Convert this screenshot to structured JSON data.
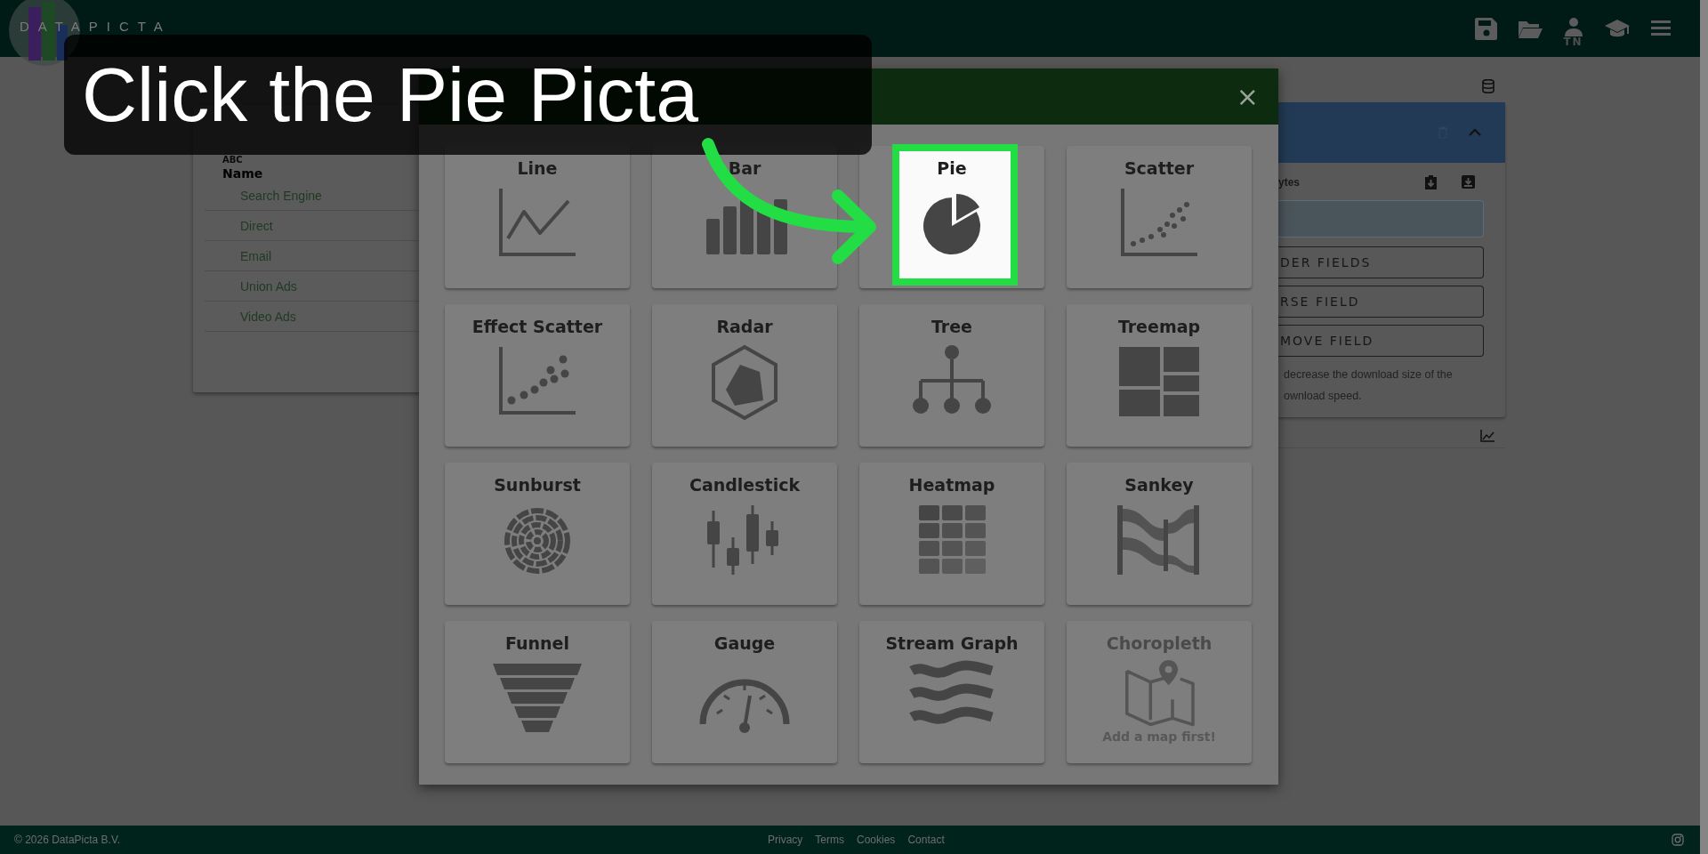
{
  "header": {
    "logo_text": "DATAPICTA",
    "user_initials": "TN"
  },
  "table": {
    "type_label": "ABC",
    "column": "Name",
    "rows": [
      "Search Engine",
      "Direct",
      "Email",
      "Union Ads",
      "Video Ads"
    ]
  },
  "side_panel": {
    "field_label": "ytes",
    "buttons": [
      "DER FIELDS",
      "RSE FIELD",
      "MOVE FIELD"
    ],
    "note_lines": [
      "decrease the download size of the",
      "ownload speed."
    ]
  },
  "dialog": {
    "close": "×",
    "cards": [
      {
        "label": "Line",
        "kind": "line",
        "highlighted": false,
        "disabled": false
      },
      {
        "label": "Bar",
        "kind": "bar",
        "highlighted": false,
        "disabled": false
      },
      {
        "label": "Pie",
        "kind": "pie",
        "highlighted": true,
        "disabled": false
      },
      {
        "label": "Scatter",
        "kind": "scatter",
        "highlighted": false,
        "disabled": false
      },
      {
        "label": "Effect Scatter",
        "kind": "effectscatter",
        "highlighted": false,
        "disabled": false
      },
      {
        "label": "Radar",
        "kind": "radar",
        "highlighted": false,
        "disabled": false
      },
      {
        "label": "Tree",
        "kind": "tree",
        "highlighted": false,
        "disabled": false
      },
      {
        "label": "Treemap",
        "kind": "treemap",
        "highlighted": false,
        "disabled": false
      },
      {
        "label": "Sunburst",
        "kind": "sunburst",
        "highlighted": false,
        "disabled": false
      },
      {
        "label": "Candlestick",
        "kind": "candlestick",
        "highlighted": false,
        "disabled": false
      },
      {
        "label": "Heatmap",
        "kind": "heatmap",
        "highlighted": false,
        "disabled": false
      },
      {
        "label": "Sankey",
        "kind": "sankey",
        "highlighted": false,
        "disabled": false
      },
      {
        "label": "Funnel",
        "kind": "funnel",
        "highlighted": false,
        "disabled": false
      },
      {
        "label": "Gauge",
        "kind": "gauge",
        "highlighted": false,
        "disabled": false
      },
      {
        "label": "Stream Graph",
        "kind": "stream",
        "highlighted": false,
        "disabled": false
      },
      {
        "label": "Choropleth",
        "kind": "choropleth",
        "highlighted": false,
        "disabled": true,
        "note": "Add a map first!"
      }
    ]
  },
  "tutorial": {
    "caption": "Click the Pie Picta"
  },
  "footer": {
    "copyright": "© 2026 DataPicta B.V.",
    "links": [
      "Privacy",
      "Terms",
      "Cookies",
      "Contact"
    ]
  }
}
